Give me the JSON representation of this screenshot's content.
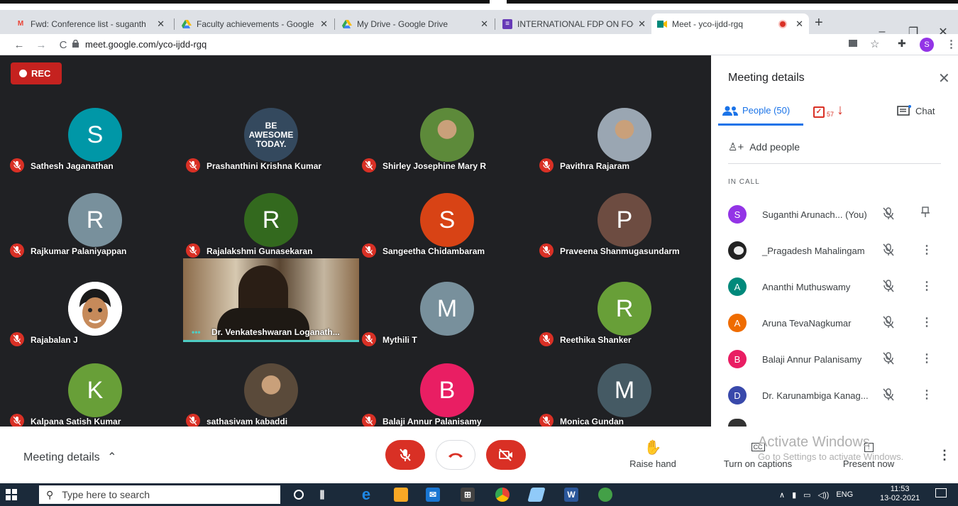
{
  "browser": {
    "tabs": [
      {
        "title": "Fwd: Conference list - suganth",
        "icon": "gmail-icon",
        "color": "#ea4335"
      },
      {
        "title": "Faculty achievements - Google",
        "icon": "drive-icon",
        "color": "#fbbc04"
      },
      {
        "title": "My Drive - Google Drive",
        "icon": "drive-icon",
        "color": "#34a853"
      },
      {
        "title": "INTERNATIONAL FDP ON FOG",
        "icon": "forms-icon",
        "color": "#673ab7"
      },
      {
        "title": "Meet - yco-ijdd-rgq",
        "icon": "meet-icon",
        "color": "#00897b"
      }
    ],
    "url": "meet.google.com/yco-ijdd-rgq",
    "profile_initial": "S"
  },
  "meeting": {
    "rec_label": "REC",
    "tiles": [
      {
        "name": "Sathesh Jaganathan",
        "initial": "S",
        "color": "#0097a7",
        "kind": "letter"
      },
      {
        "name": "Prashanthini Krishna Kumar",
        "initial": "BE AWESOME TODAY.",
        "color": "#34495e",
        "kind": "text"
      },
      {
        "name": "Shirley Josephine Mary R",
        "initial": "",
        "color": "#5d8a3a",
        "kind": "photo"
      },
      {
        "name": "Pavithra Rajaram",
        "initial": "",
        "color": "#9aa6b2",
        "kind": "photo"
      },
      {
        "name": "Rajkumar Palaniyappan",
        "initial": "R",
        "color": "#78909c",
        "kind": "letter"
      },
      {
        "name": "Rajalakshmi Gunasekaran",
        "initial": "R",
        "color": "#33691e",
        "kind": "letter"
      },
      {
        "name": "Sangeetha Chidambaram",
        "initial": "S",
        "color": "#d84315",
        "kind": "letter"
      },
      {
        "name": "Praveena Shanmugasundarm",
        "initial": "P",
        "color": "#6d4c41",
        "kind": "letter"
      },
      {
        "name": "Rajabalan J",
        "initial": "",
        "color": "#ffffff",
        "kind": "cartoon"
      },
      {
        "name": "Mythili T",
        "initial": "M",
        "color": "#78909c",
        "kind": "letter"
      },
      {
        "name": "Reethika Shanker",
        "initial": "R",
        "color": "#689f38",
        "kind": "letter"
      },
      {
        "name": "Kalpana Satish Kumar",
        "initial": "K",
        "color": "#689f38",
        "kind": "letter"
      },
      {
        "name": "sathasivam kabaddi",
        "initial": "",
        "color": "#5a4a3a",
        "kind": "photo"
      },
      {
        "name": "Balaji Annur Palanisamy",
        "initial": "B",
        "color": "#e91e63",
        "kind": "letter"
      },
      {
        "name": "Monica Gundan",
        "initial": "M",
        "color": "#455a64",
        "kind": "letter"
      }
    ],
    "video_tile_name": "Dr. Venkateshwaran Loganath..."
  },
  "sidebar": {
    "title": "Meeting details",
    "people_tab": "People (50)",
    "activity_count": "57",
    "chat_tab": "Chat",
    "add_people": "Add people",
    "in_call": "IN CALL",
    "participants": [
      {
        "name": "Suganthi Arunach... (You)",
        "initial": "S",
        "color": "#9334e6",
        "action": "pin"
      },
      {
        "name": "_Pragadesh Mahalingam",
        "initial": "",
        "color": "#222222",
        "action": "more"
      },
      {
        "name": "Ananthi Muthuswamy",
        "initial": "A",
        "color": "#00897b",
        "action": "more"
      },
      {
        "name": "Aruna TevaNagkumar",
        "initial": "A",
        "color": "#ef6c00",
        "action": "more"
      },
      {
        "name": "Balaji Annur Palanisamy",
        "initial": "B",
        "color": "#e91e63",
        "action": "more"
      },
      {
        "name": "Dr. Karunambiga Kanag...",
        "initial": "D",
        "color": "#3949ab",
        "action": "more"
      }
    ]
  },
  "controls": {
    "meeting_details": "Meeting details",
    "raise_hand": "Raise hand",
    "captions": "Turn on captions",
    "present": "Present now",
    "watermark_title": "Activate Windows",
    "watermark_sub": "Go to Settings to activate Windows."
  },
  "taskbar": {
    "search_placeholder": "Type here to search",
    "lang": "ENG",
    "time": "11:53",
    "date": "13-02-2021"
  },
  "colors": {
    "red": "#d93025",
    "blue": "#1a73e8",
    "stage": "#202124"
  }
}
